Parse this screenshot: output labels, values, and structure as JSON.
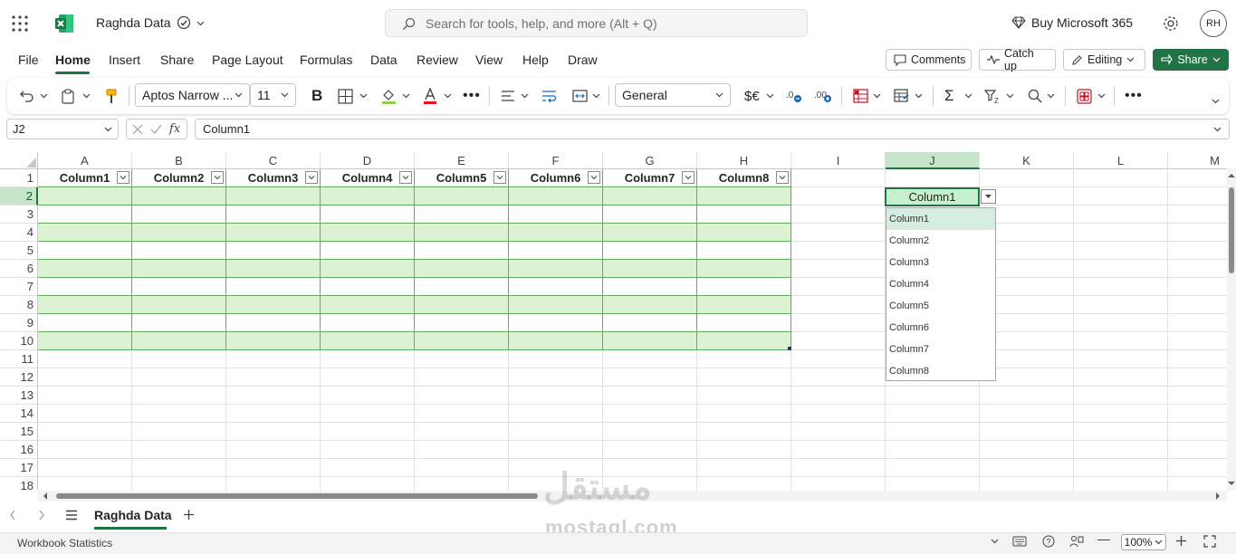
{
  "app": {
    "doc_name": "Raghda Data",
    "search_placeholder": "Search for tools, help, and more (Alt + Q)",
    "buy_label": "Buy Microsoft 365",
    "avatar_initials": "RH"
  },
  "menu": {
    "tabs": [
      "File",
      "Home",
      "Insert",
      "Share",
      "Page Layout",
      "Formulas",
      "Data",
      "Review",
      "View",
      "Help",
      "Draw"
    ],
    "active_tab": "Home",
    "comments_label": "Comments",
    "catchup_label": "Catch up",
    "editing_label": "Editing",
    "share_label": "Share"
  },
  "ribbon": {
    "font_name": "Aptos Narrow ...",
    "font_size": "11",
    "number_format": "General",
    "currency_label": "$€"
  },
  "formula_bar": {
    "name_box": "J2",
    "fx_label": "fx",
    "formula": "Column1"
  },
  "grid": {
    "columns": [
      "A",
      "B",
      "C",
      "D",
      "E",
      "F",
      "G",
      "H",
      "I",
      "J",
      "K",
      "L",
      "M"
    ],
    "rows": [
      "1",
      "2",
      "3",
      "4",
      "5",
      "6",
      "7",
      "8",
      "9",
      "10",
      "11",
      "12",
      "13",
      "14",
      "15",
      "16",
      "17",
      "18"
    ],
    "table_headers": [
      "Column1",
      "Column2",
      "Column3",
      "Column4",
      "Column5",
      "Column6",
      "Column7",
      "Column8"
    ],
    "selected_cell_value": "Column1",
    "selected_column": "J",
    "selected_row": "2"
  },
  "dropdown": {
    "options": [
      "Column1",
      "Column2",
      "Column3",
      "Column4",
      "Column5",
      "Column6",
      "Column7",
      "Column8"
    ],
    "highlighted": "Column1"
  },
  "sheets": {
    "active": "Raghda Data"
  },
  "status": {
    "workbook_stats": "Workbook Statistics",
    "zoom": "100%"
  },
  "watermark": {
    "arabic": "مستقل",
    "latin": "mostaql.com"
  },
  "colors": {
    "accent": "#217346",
    "table_band": "#dcf2d3",
    "table_border": "#5fae5f",
    "selected_header": "#c6e5cb"
  }
}
